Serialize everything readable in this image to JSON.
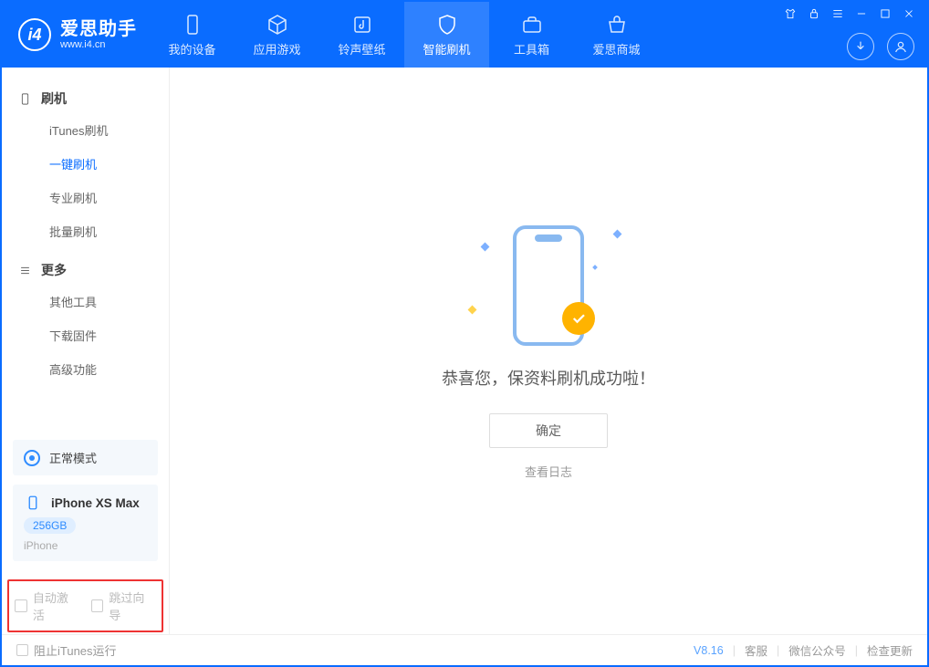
{
  "app": {
    "name": "爱思助手",
    "domain": "www.i4.cn"
  },
  "tabs": [
    {
      "label": "我的设备"
    },
    {
      "label": "应用游戏"
    },
    {
      "label": "铃声壁纸"
    },
    {
      "label": "智能刷机"
    },
    {
      "label": "工具箱"
    },
    {
      "label": "爱思商城"
    }
  ],
  "sidebar": {
    "section1": {
      "title": "刷机",
      "items": [
        "iTunes刷机",
        "一键刷机",
        "专业刷机",
        "批量刷机"
      ]
    },
    "section2": {
      "title": "更多",
      "items": [
        "其他工具",
        "下载固件",
        "高级功能"
      ]
    },
    "mode": {
      "label": "正常模式"
    },
    "device": {
      "name": "iPhone XS Max",
      "storage": "256GB",
      "type": "iPhone"
    },
    "checks": {
      "auto_activate": "自动激活",
      "skip_wizard": "跳过向导"
    }
  },
  "main": {
    "message": "恭喜您，保资料刷机成功啦！",
    "ok": "确定",
    "viewlog": "查看日志"
  },
  "footer": {
    "block_itunes": "阻止iTunes运行",
    "version": "V8.16",
    "service": "客服",
    "wechat": "微信公众号",
    "update": "检查更新"
  }
}
